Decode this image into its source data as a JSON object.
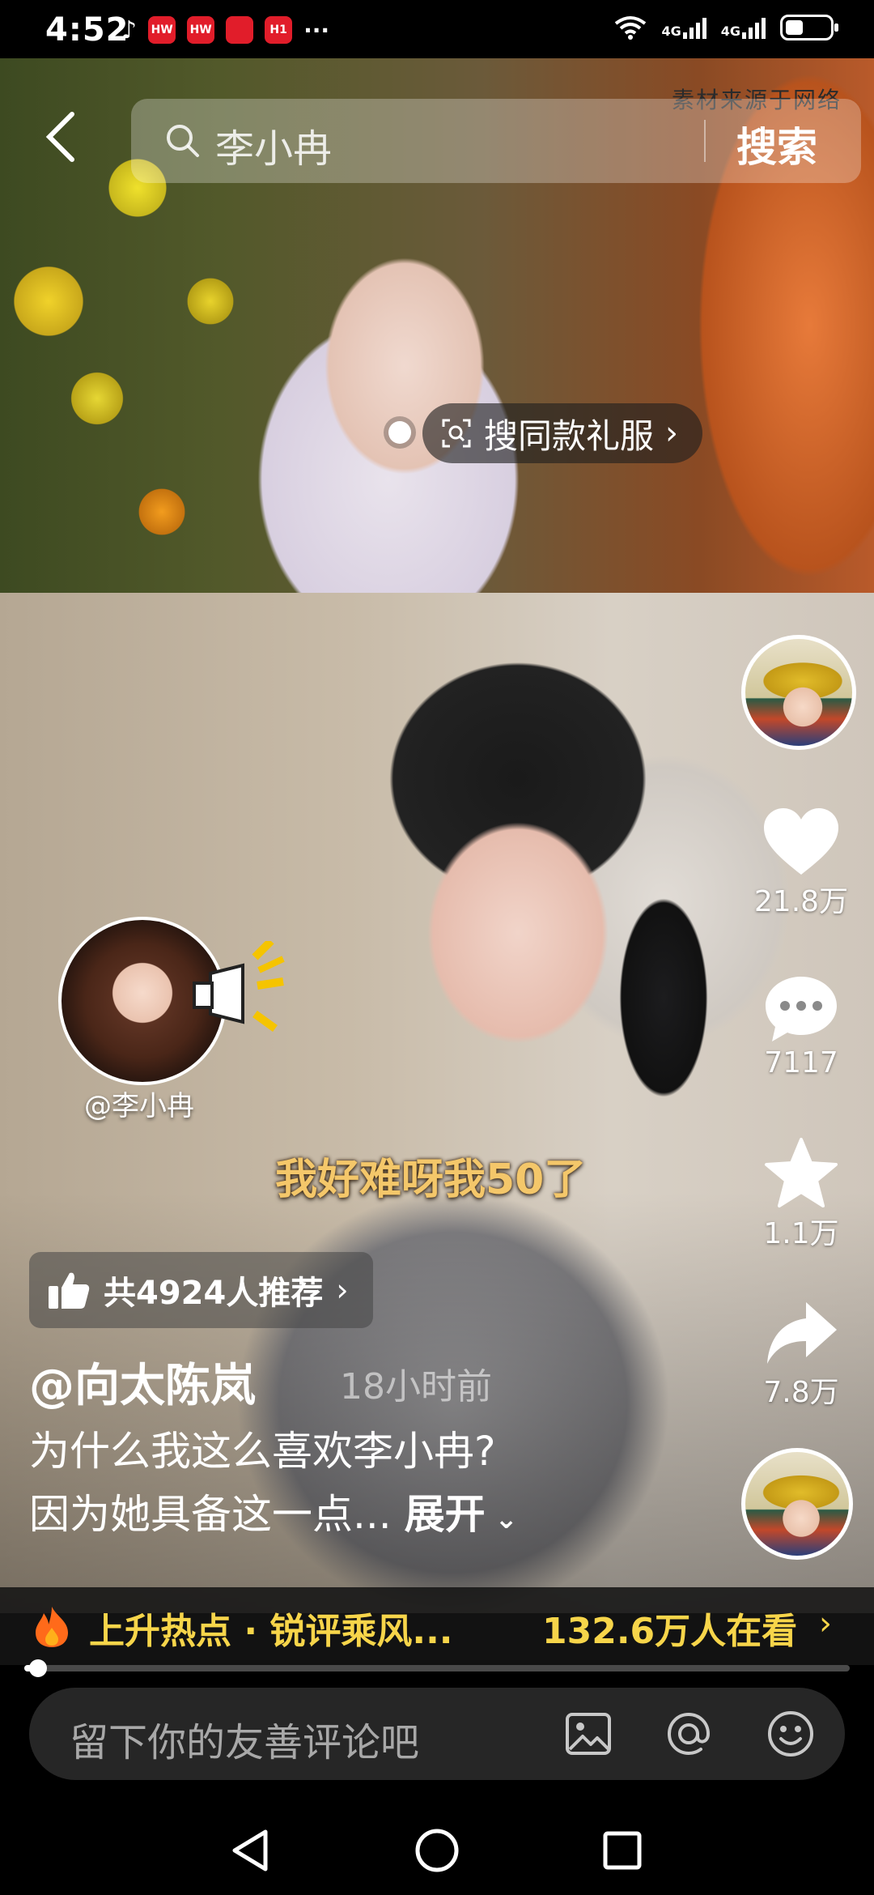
{
  "status_bar": {
    "time": "4:52",
    "app_icons": [
      "tiktok-icon",
      "huawei-icon",
      "huawei-icon",
      "app-icon",
      "app-icon"
    ],
    "app_labels": [
      "♪",
      "HW",
      "HW",
      "",
      "H1"
    ],
    "more": "···",
    "network1": "4G",
    "network2": "4G",
    "battery_level_percent": 40
  },
  "top_video": {
    "watermark": "素材来源于网络",
    "search_query": "李小冉",
    "search_button": "搜索",
    "shop_pill": "搜同款礼服"
  },
  "main_video": {
    "tag_label": "@李小冉",
    "subtitle": "我好难呀我50了",
    "recommend": "共4924人推荐",
    "author": "@向太陈岚",
    "post_time": "18小时前",
    "description_line1": "为什么我这么喜欢李小冉?",
    "description_line2": "因为她具备这一点...",
    "expand": "展开"
  },
  "right_rail": {
    "likes": "21.8万",
    "comments": "7117",
    "favorites": "1.1万",
    "shares": "7.8万"
  },
  "hot_bar": {
    "text": "上升热点 · 锐评乘风...",
    "viewers": "132.6万人在看",
    "chevron": "›"
  },
  "playback": {
    "progress_percent": 1
  },
  "comment_bar": {
    "placeholder": "留下你的友善评论吧"
  },
  "colors": {
    "accent_yellow": "#f7d54a",
    "subtitle_gold": "#f4c76a",
    "flame": "#ff6a1a"
  }
}
